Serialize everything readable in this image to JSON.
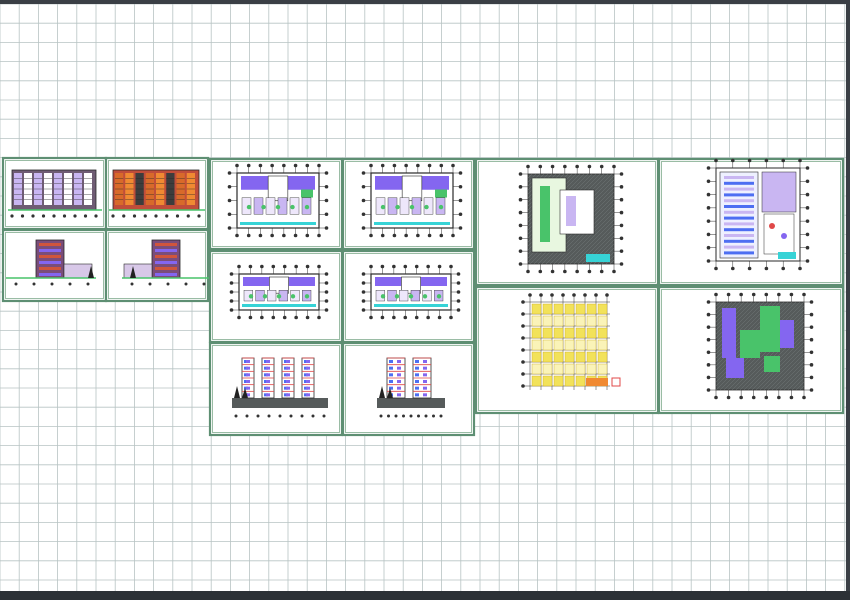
{
  "canvas": {
    "background": "#ffffff",
    "grid_color": "#b7c3c3",
    "grid_color_major": "#9aa8a8",
    "frame_color": "#5e8f73",
    "frame_color_inner": "#6fa07f"
  },
  "palette": {
    "wall": "#2a2a2a",
    "axis": "#333333",
    "purple": "#8466f0",
    "lilac": "#c9b6f2",
    "green": "#49c36a",
    "cyan": "#37d3d6",
    "orange": "#f08a32",
    "yellow": "#f2e25a",
    "red": "#e04848",
    "blue": "#4d6ef2",
    "gray": "#8a8a8a",
    "darkgray": "#565b5b"
  },
  "sheets": [
    {
      "type": "elevation",
      "variant": "banded"
    },
    {
      "type": "elevation",
      "variant": "orange"
    },
    {
      "type": "side-elevation",
      "variant": "left"
    },
    {
      "type": "side-elevation",
      "variant": "right"
    },
    {
      "type": "floor-plan",
      "variant": "ground"
    },
    {
      "type": "floor-plan",
      "variant": "first"
    },
    {
      "type": "floor-plan",
      "variant": "typical-a"
    },
    {
      "type": "floor-plan",
      "variant": "typical-b"
    },
    {
      "type": "section",
      "variant": "long"
    },
    {
      "type": "section",
      "variant": "short"
    },
    {
      "type": "site-plan",
      "variant": "square"
    },
    {
      "type": "site-plan",
      "variant": "tall"
    },
    {
      "type": "structural-grid",
      "variant": "yellow"
    },
    {
      "type": "site-plan",
      "variant": "green"
    }
  ]
}
